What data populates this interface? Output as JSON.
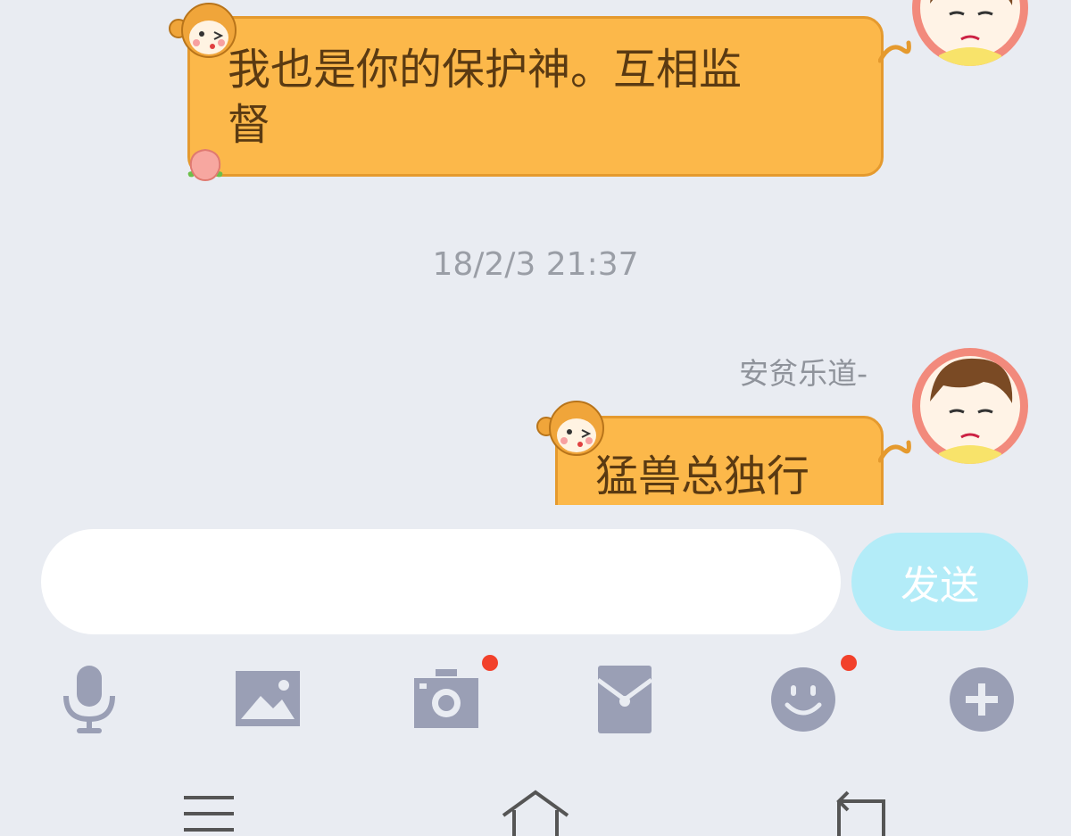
{
  "messages": [
    {
      "text": "我也是你的保护神。互相监督",
      "line1": "我也是你的保护神。互相监",
      "line2": "督"
    },
    {
      "text": "猛兽总独行"
    }
  ],
  "timestamp": "18/2/3 21:37",
  "sender_name": "安贫乐道-",
  "composer": {
    "input_value": "",
    "send_label": "发送"
  },
  "toolbar": {
    "icons": [
      "microphone-icon",
      "image-icon",
      "camera-icon",
      "red-envelope-icon",
      "emoji-icon",
      "plus-icon"
    ],
    "badges": [
      "camera",
      "emoji"
    ]
  },
  "nav": {
    "icons": [
      "menu-icon",
      "home-icon",
      "back-icon"
    ]
  },
  "colors": {
    "background": "#e9ecf2",
    "bubble": "#fcb84a",
    "bubble_border": "#e59a2e",
    "bubble_text": "#5a3a12",
    "send_button": "#b3ecf8",
    "icon": "#9a9fb5",
    "badge": "#f2412b",
    "avatar_ring": "#f28a7c"
  }
}
